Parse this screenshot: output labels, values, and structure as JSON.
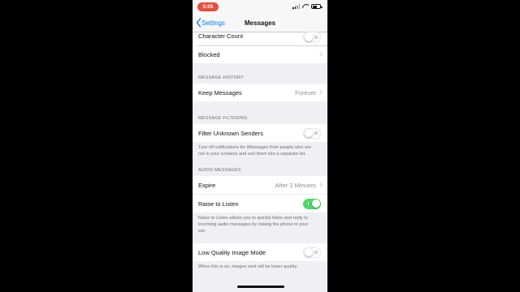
{
  "status_bar": {
    "time": "5:05"
  },
  "nav": {
    "back_label": "Settings",
    "title": "Messages"
  },
  "rows": {
    "character_count": {
      "label": "Character Count",
      "toggle": "off"
    },
    "blocked": {
      "label": "Blocked"
    },
    "keep_messages": {
      "label": "Keep Messages",
      "value": "Forever"
    },
    "filter_unknown": {
      "label": "Filter Unknown Senders",
      "toggle": "off"
    },
    "expire": {
      "label": "Expire",
      "value": "After 2 Minutes"
    },
    "raise_to_listen": {
      "label": "Raise to Listen",
      "toggle": "on"
    },
    "low_quality": {
      "label": "Low Quality Image Mode",
      "toggle": "off"
    }
  },
  "sections": {
    "message_history": "MESSAGE HISTORY",
    "message_filtering": "MESSAGE FILTERING",
    "audio_messages": "AUDIO MESSAGES"
  },
  "footers": {
    "filter_line1": "Turn off notifications for iMessages from people who are",
    "filter_line2": "not in your contacts and sort them into a separate list.",
    "raise_line1": "Raise to Listen allows you to quickly listen and reply to",
    "raise_line2": "incoming audio messages by raising the phone to your",
    "raise_line3": "ear.",
    "low_quality": "When this is on, images sent will be lower quality."
  },
  "colors": {
    "accent": "#007aff",
    "toggle_on": "#4cd964",
    "time_pill": "#e74c3c",
    "background": "#efeff4"
  }
}
